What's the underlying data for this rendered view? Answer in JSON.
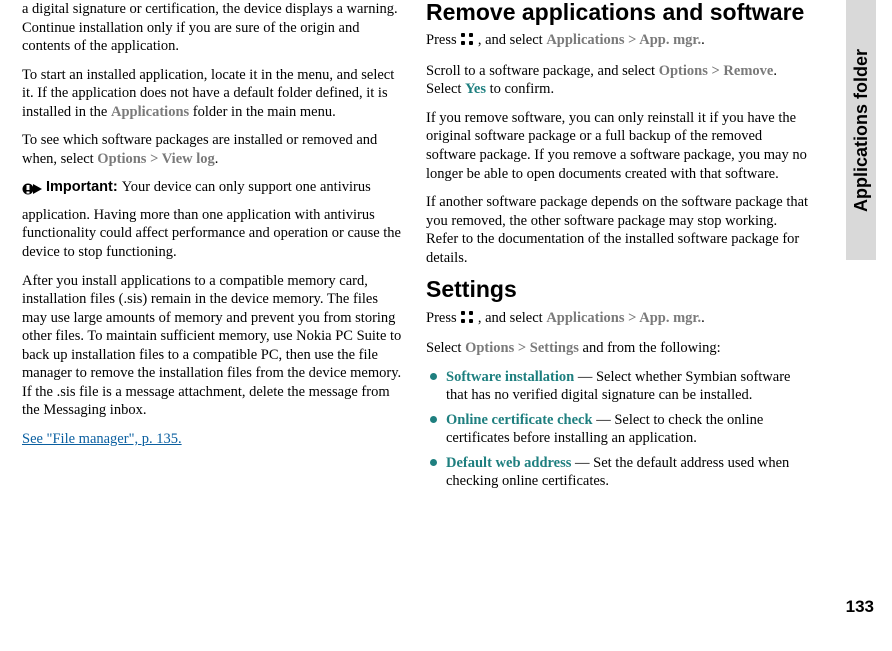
{
  "sideTab": "Applications folder",
  "pageNumber": "133",
  "left": {
    "p1a": "a digital signature or certification, the device displays a warning. Continue installation only if you are sure of the origin and contents of the application.",
    "p2a": "To start an installed application, locate it in the menu, and select it. If the application does not have a default folder defined, it is installed in the ",
    "p2b": "Applications",
    "p2c": " folder in the main menu.",
    "p3a": "To see which software packages are installed or removed and when, select ",
    "p3b": "Options",
    "p3c": " > ",
    "p3d": "View log",
    "p3e": ".",
    "p4label": "Important:  ",
    "p4text": "Your device can only support one antivirus application. Having more than one application with antivirus functionality could affect performance and operation or cause the device to stop functioning.",
    "p5": "After you install applications to a compatible memory card, installation files (.sis) remain in the device memory. The files may use large amounts of memory and prevent you from storing other files. To maintain sufficient memory, use Nokia PC Suite to back up installation files to a compatible PC, then use the file manager to remove the installation files from the device memory. If the .sis file is a message attachment, delete the message from the Messaging inbox.",
    "link": "See \"File manager\", p. 135."
  },
  "right": {
    "h1": "Remove applications and software",
    "r1a": "Press  ",
    "r1b": " , and select ",
    "r1c": "Applications",
    "r1d": " > ",
    "r1e": " App. mgr.",
    "r1f": ".",
    "r2a": "Scroll to a software package, and select ",
    "r2b": "Options",
    "r2c": " > ",
    "r2d": "Remove",
    "r2e": ". Select ",
    "r2f": "Yes",
    "r2g": " to confirm.",
    "r3": "If you remove software, you can only reinstall it if you have the original software package or a full backup of the removed software package. If you remove a software package, you may no longer be able to open documents created with that software.",
    "r4": "If another software package depends on the software package that you removed, the other software package may stop working. Refer to the documentation of the installed software package for details.",
    "h2": "Settings",
    "s1a": "Press  ",
    "s1b": " , and select ",
    "s1c": "Applications",
    "s1d": " > ",
    "s1e": " App. mgr.",
    "s1f": ".",
    "s2a": "Select ",
    "s2b": "Options",
    "s2c": " > ",
    "s2d": " Settings",
    "s2e": " and from the following:",
    "b1a": "Software installation",
    "b1b": " — Select whether Symbian software that has no verified digital signature can be installed.",
    "b2a": "Online certificate check",
    "b2b": "  — Select to check the online certificates before installing an application.",
    "b3a": "Default web address",
    "b3b": " — Set the default address used when checking online certificates."
  }
}
